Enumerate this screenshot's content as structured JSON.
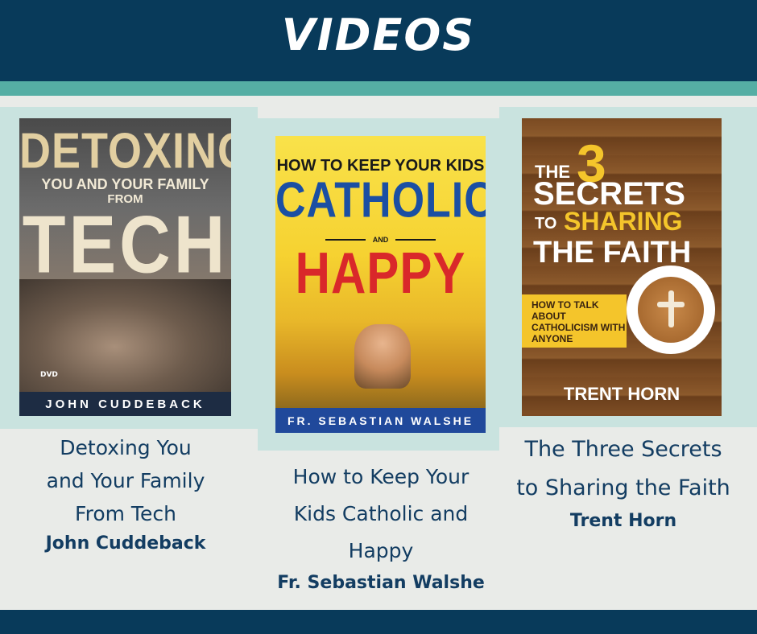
{
  "header": {
    "title": "VIDEOS"
  },
  "colors": {
    "navy": "#083a5a",
    "teal": "#55aea4",
    "panel": "#c9e3df",
    "background": "#e9ebe8",
    "caption_text": "#133d62"
  },
  "videos": [
    {
      "cover": {
        "line1": "DETOXING",
        "line2": "YOU AND YOUR FAMILY",
        "line3": "FROM",
        "line4": "TECH",
        "badge": "DVD",
        "author": "JOHN CUDDEBACK"
      },
      "title_lines": [
        "Detoxing You",
        "and Your Family",
        "From Tech"
      ],
      "author": "John Cuddeback"
    },
    {
      "cover": {
        "line1": "HOW TO KEEP YOUR KIDS",
        "line2": "CATHOLIC",
        "line3": "AND",
        "line4": "HAPPY",
        "author": "FR. SEBASTIAN WALSHE"
      },
      "title_lines": [
        "How to Keep Your",
        "Kids Catholic and",
        "Happy"
      ],
      "author": "Fr. Sebastian Walshe"
    },
    {
      "cover": {
        "the": "THE",
        "number": "3",
        "secrets": "SECRETS",
        "to": "TO",
        "sharing": "SHARING",
        "faith": "THE FAITH",
        "subtitle": "HOW TO TALK ABOUT CATHOLICISM WITH ANYONE",
        "author": "TRENT HORN"
      },
      "title_lines": [
        "The Three Secrets",
        "to Sharing the Faith"
      ],
      "author": "Trent Horn"
    }
  ]
}
